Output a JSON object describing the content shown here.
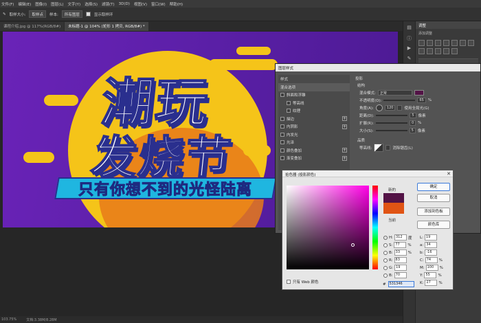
{
  "menubar": [
    "文件(F)",
    "编辑(E)",
    "图像(I)",
    "图层(L)",
    "文字(Y)",
    "选择(S)",
    "滤镜(T)",
    "3D(D)",
    "视图(V)",
    "窗口(W)",
    "帮助(H)"
  ],
  "options": {
    "sample_size_label": "取样大小:",
    "sample_size_value": "取样点",
    "sample_label": "样本:",
    "sample_value": "所有图层",
    "show_ring_label": "显示取样环"
  },
  "tabs": [
    "课程介绍.jpg @ 117%(RGB/8#)",
    "未标题-1 @ 104% (矩形 1 拷贝, RGB/8#) *"
  ],
  "canvas": {
    "headline1": "潮玩",
    "headline2": "发烧节",
    "slogan": "只有你想不到的光怪陆离"
  },
  "statusbar": {
    "zoom": "103.75%",
    "doc": "文档:3.38M/8.28M"
  },
  "right_panel": {
    "tab": "调整",
    "subtitle": "添加调整"
  },
  "layer_style": {
    "title": "图层样式",
    "left_header": "样式",
    "items": [
      {
        "label": "混合选项",
        "checkbox": false,
        "sub": false,
        "plus": false,
        "hl": true
      },
      {
        "label": "斜面和浮雕",
        "checkbox": true,
        "sub": false,
        "plus": false,
        "hl": false
      },
      {
        "label": "等高线",
        "checkbox": true,
        "sub": true,
        "plus": false,
        "hl": false
      },
      {
        "label": "纹理",
        "checkbox": true,
        "sub": true,
        "plus": false,
        "hl": false
      },
      {
        "label": "描边",
        "checkbox": true,
        "sub": false,
        "plus": true,
        "hl": false
      },
      {
        "label": "内阴影",
        "checkbox": true,
        "sub": false,
        "plus": true,
        "hl": false
      },
      {
        "label": "内发光",
        "checkbox": true,
        "sub": false,
        "plus": false,
        "hl": false
      },
      {
        "label": "光泽",
        "checkbox": true,
        "sub": false,
        "plus": false,
        "hl": false
      },
      {
        "label": "颜色叠加",
        "checkbox": true,
        "sub": false,
        "plus": true,
        "hl": false
      },
      {
        "label": "渐变叠加",
        "checkbox": true,
        "sub": false,
        "plus": true,
        "hl": false
      }
    ],
    "section": "投影",
    "structure": "结构",
    "blend_mode_label": "混合模式:",
    "blend_mode_value": "正常",
    "opacity_label": "不透明度(O):",
    "opacity_value": "65",
    "angle_label": "角度(A):",
    "angle_value": "120",
    "global_light": "使用全局光(G)",
    "distance_label": "距离(D):",
    "distance_value": "5",
    "spread_label": "扩展(R):",
    "spread_value": "0",
    "size_label": "大小(S):",
    "size_value": "5",
    "unit_px": "像素",
    "unit_pct": "%",
    "quality": "品质",
    "contour_label": "等高线:",
    "antialias": "消除锯齿(L)",
    "swatch_color": "#531346"
  },
  "picker": {
    "title": "拾色器 (投影颜色)",
    "new_label": "新的",
    "current_label": "当前",
    "new_color": "#531346",
    "current_color": "#e05414",
    "buttons": [
      "确定",
      "取消",
      "添加到色板",
      "颜色库"
    ],
    "hsb": [
      {
        "k": "H:",
        "v": "312",
        "u": "度",
        "on": true
      },
      {
        "k": "S:",
        "v": "77",
        "u": "%",
        "on": false
      },
      {
        "k": "B:",
        "v": "33",
        "u": "%",
        "on": false
      },
      {
        "k": "R:",
        "v": "83",
        "u": "",
        "on": false
      },
      {
        "k": "G:",
        "v": "19",
        "u": "",
        "on": false
      },
      {
        "k": "B:",
        "v": "70",
        "u": "",
        "on": false
      }
    ],
    "lab": [
      {
        "k": "L:",
        "v": "19",
        "u": ""
      },
      {
        "k": "a:",
        "v": "34",
        "u": ""
      },
      {
        "k": "b:",
        "v": "-16",
        "u": ""
      },
      {
        "k": "C:",
        "v": "74",
        "u": "%"
      },
      {
        "k": "M:",
        "v": "100",
        "u": "%"
      },
      {
        "k": "Y:",
        "v": "55",
        "u": "%"
      },
      {
        "k": "K:",
        "v": "27",
        "u": "%"
      }
    ],
    "web_only": "只有 Web 颜色",
    "hex_label": "#",
    "hex_value": "531346"
  }
}
